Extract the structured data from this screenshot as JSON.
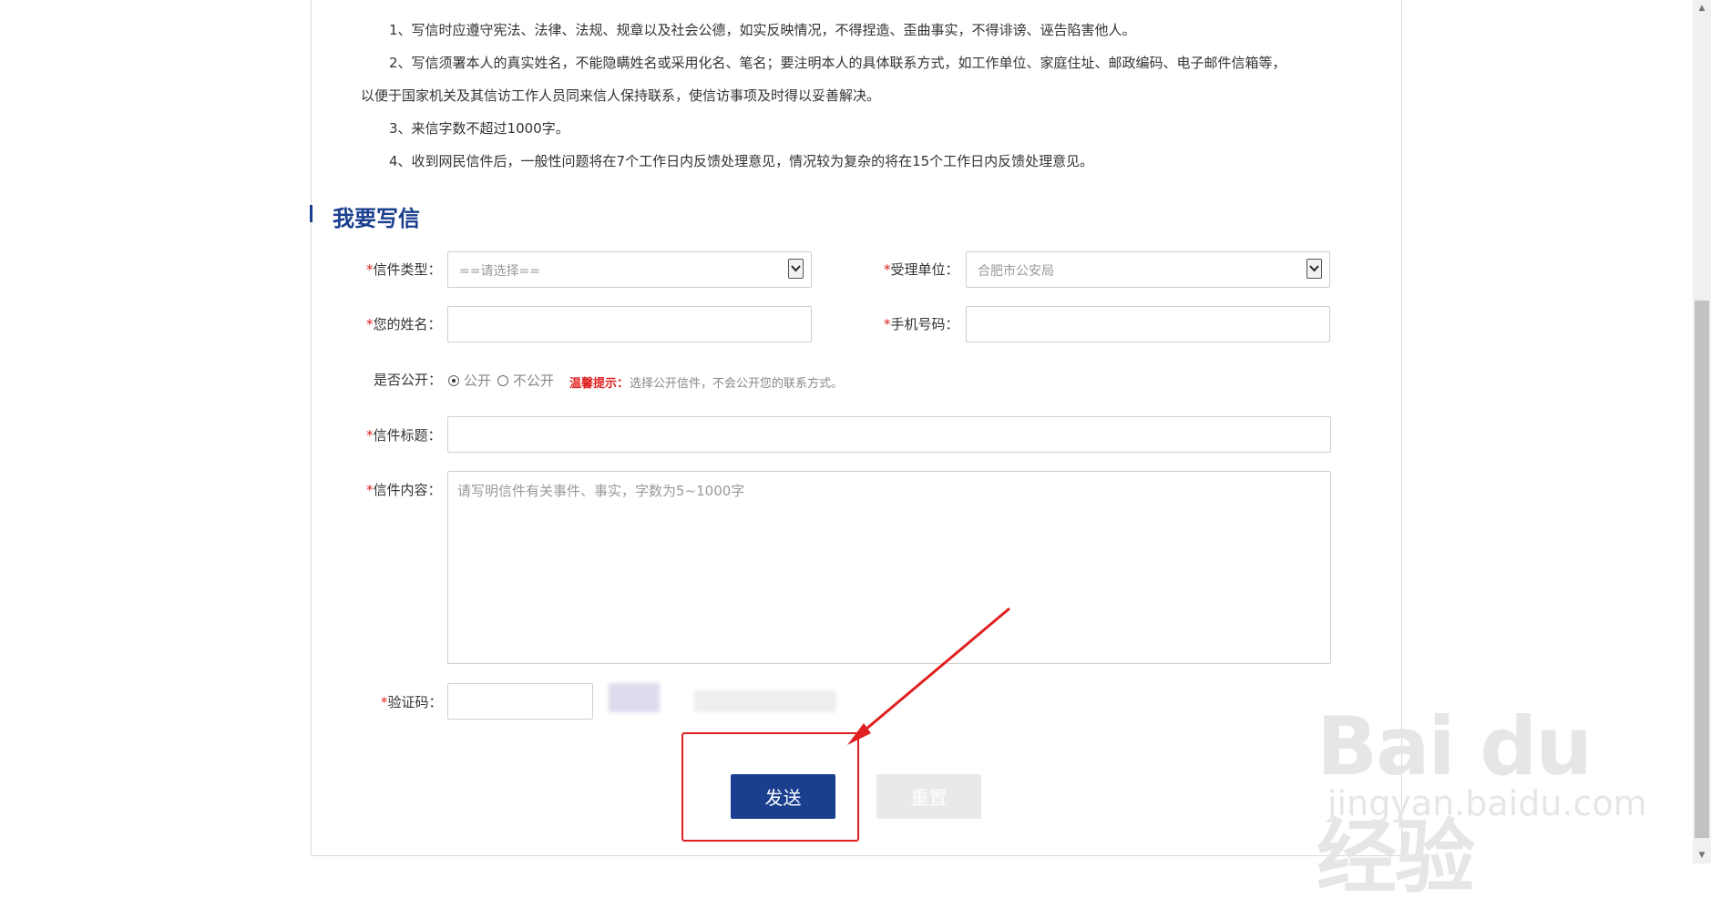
{
  "notice": {
    "items": [
      "1、写信时应遵守宪法、法律、法规、规章以及社会公德，如实反映情况，不得捏造、歪曲事实，不得诽谤、诬告陷害他人。",
      "2、写信须署本人的真实姓名，不能隐瞒姓名或采用化名、笔名；要注明本人的具体联系方式，如工作单位、家庭住址、邮政编码、电子邮件信箱等，",
      "以便于国家机关及其信访工作人员同来信人保持联系，使信访事项及时得以妥善解决。",
      "3、来信字数不超过1000字。",
      "4、收到网民信件后，一般性问题将在7个工作日内反馈处理意见，情况较为复杂的将在15个工作日内反馈处理意见。"
    ]
  },
  "section": {
    "title": "我要写信"
  },
  "form": {
    "required_mark": "*",
    "letter_type": {
      "label": "信件类型：",
      "value": "==请选择=="
    },
    "unit": {
      "label": "受理单位：",
      "value": "合肥市公安局"
    },
    "name": {
      "label": "您的姓名：",
      "value": ""
    },
    "phone": {
      "label": "手机号码：",
      "value": ""
    },
    "public": {
      "label": "是否公开：",
      "option_yes": "公开",
      "option_no": "不公开",
      "selected": "公开",
      "tip_title": "温馨提示：",
      "tip_text": "选择公开信件，不会公开您的联系方式。"
    },
    "subject": {
      "label": "信件标题：",
      "value": ""
    },
    "content": {
      "label": "信件内容：",
      "placeholder": "请写明信件有关事件、事实，字数为5~1000字"
    },
    "captcha": {
      "label": "验证码：",
      "value": ""
    }
  },
  "buttons": {
    "send": "发送",
    "reset": "重置"
  },
  "watermark": {
    "main": "Bai du 经验",
    "sub": "jingyan.baidu.com"
  },
  "colors": {
    "accent": "#1b3f8f",
    "required": "#e02020",
    "annotation": "#e02020"
  }
}
